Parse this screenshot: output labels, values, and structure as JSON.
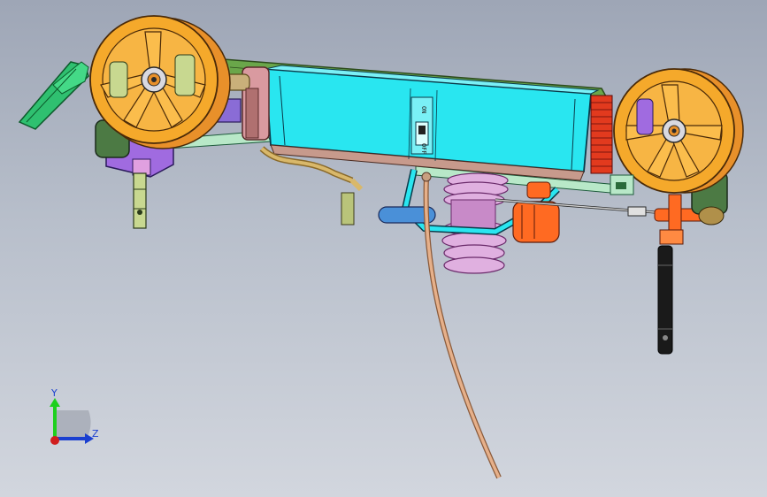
{
  "viewport": {
    "background_top": "#9ea6b6",
    "background_bottom": "#d2d6de"
  },
  "model": {
    "switch_label_top": "ON",
    "switch_label_bottom": "OFF",
    "colors": {
      "body": "#29e6f0",
      "wheel": "#f5a92b",
      "hub": "#e8902a",
      "chassis_plate": "#6aa64a",
      "engine_fins": "#d080c0",
      "fuel_line": "#d9a07a",
      "purple_parts": "#a06be0",
      "green_bumper": "#2fc070",
      "gear": "#e23a1e",
      "orange_parts": "#ff6a22",
      "blue_parts": "#4a90d8"
    }
  },
  "triad": {
    "y_label": "Y",
    "z_label": "Z",
    "y_color": "#1ed01e",
    "z_color": "#1a3fd0",
    "x_color": "#d01e1e"
  }
}
